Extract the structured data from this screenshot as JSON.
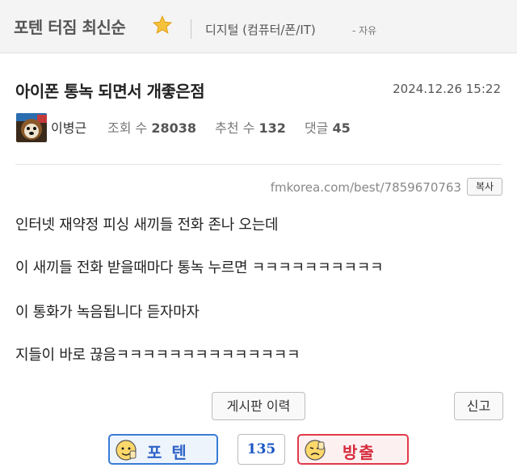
{
  "header": {
    "board_title": "포텐 터짐 최신순",
    "star_icon": "star-icon",
    "category": "디지털 (컴퓨터/폰/IT)",
    "category_sub": "- 자유"
  },
  "post": {
    "title": "아이폰 통녹 되면서 개좋은점",
    "date": "2024.12.26 15:22",
    "author": "이병근",
    "views_label": "조회 수",
    "views": "28038",
    "recommend_label": "추천 수",
    "recommend": "132",
    "comments_label": "댓글",
    "comments": "45",
    "url": "fmkorea.com/best/7859670763",
    "copy_label": "복사",
    "body": [
      "인터넷 재약정 피싱 새끼들 전화 존나 오는데",
      "이 새끼들 전화 받을때마다 통녹 누르면 ㅋㅋㅋㅋㅋㅋㅋㅋㅋㅋ",
      "이 통화가 녹음됩니다 듣자마자",
      "지들이 바로 끊음ㅋㅋㅋㅋㅋㅋㅋㅋㅋㅋㅋㅋㅋㅋ"
    ]
  },
  "actions": {
    "history_label": "게시판 이력",
    "report_label": "신고",
    "vote_up_label": "포텐",
    "vote_count": "135",
    "vote_down_label": "방출"
  },
  "colors": {
    "accent_blue": "#3a7bd5",
    "accent_red": "#e03a4a",
    "count_blue": "#1a56c4"
  }
}
